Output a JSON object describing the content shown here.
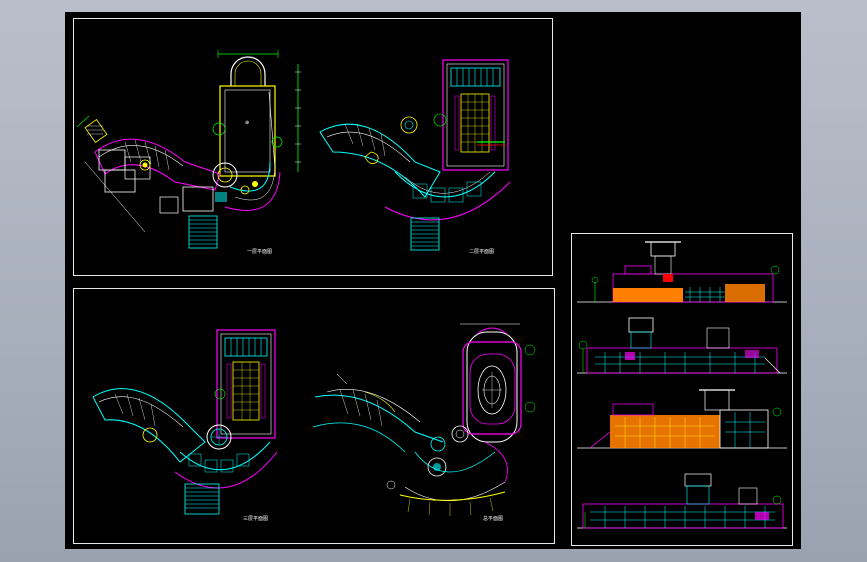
{
  "app": {
    "canvas_background": "#000000",
    "desktop_background": "#aab1be"
  },
  "colors": {
    "cyan": "#00ffff",
    "magenta": "#ff00ff",
    "yellow": "#ffff00",
    "white": "#ffffff",
    "green": "#00ff00",
    "orange": "#ff8000",
    "red": "#ff0000",
    "blue": "#3060ff"
  },
  "sheets": [
    {
      "id": "ground-floor-plan",
      "caption": "一层平面图"
    },
    {
      "id": "second-floor-plan",
      "caption": "二层平面图"
    },
    {
      "id": "third-floor-plan",
      "caption": "三层平面图"
    },
    {
      "id": "site-plan",
      "caption": "总平面图"
    }
  ],
  "elevations": [
    {
      "id": "south-elevation"
    },
    {
      "id": "north-elevation"
    },
    {
      "id": "east-elevation"
    },
    {
      "id": "west-elevation"
    }
  ]
}
